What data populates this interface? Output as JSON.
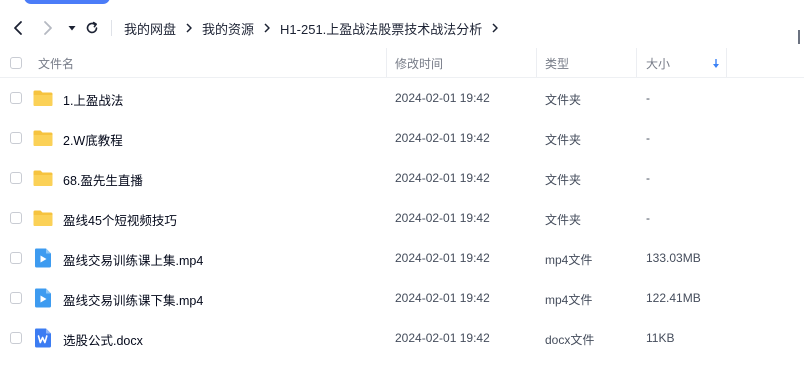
{
  "toolbar": {
    "back_icon": "chevron-left-icon",
    "forward_icon": "chevron-right-icon",
    "dropdown_icon": "caret-down-icon",
    "refresh_icon": "refresh-icon"
  },
  "breadcrumb": [
    "我的网盘",
    "我的资源",
    "H1-251.上盈战法股票技术战法分析"
  ],
  "columns": {
    "name": "文件名",
    "time": "修改时间",
    "type": "类型",
    "size": "大小"
  },
  "sort_icon": "arrow-down-icon",
  "accent": "#3b82f6",
  "files": [
    {
      "name": "1.上盈战法",
      "time": "2024-02-01 19:42",
      "type": "文件夹",
      "size": "-",
      "icon": "folder-icon"
    },
    {
      "name": "2.W底教程",
      "time": "2024-02-01 19:42",
      "type": "文件夹",
      "size": "-",
      "icon": "folder-icon"
    },
    {
      "name": "68.盈先生直播",
      "time": "2024-02-01 19:42",
      "type": "文件夹",
      "size": "-",
      "icon": "folder-icon"
    },
    {
      "name": "盈线45个短视频技巧",
      "time": "2024-02-01 19:42",
      "type": "文件夹",
      "size": "-",
      "icon": "folder-icon"
    },
    {
      "name": "盈线交易训练课上集.mp4",
      "time": "2024-02-01 19:42",
      "type": "mp4文件",
      "size": "133.03MB",
      "icon": "video-file-icon"
    },
    {
      "name": "盈线交易训练课下集.mp4",
      "time": "2024-02-01 19:42",
      "type": "mp4文件",
      "size": "122.41MB",
      "icon": "video-file-icon"
    },
    {
      "name": "选股公式.docx",
      "time": "2024-02-01 19:42",
      "type": "docx文件",
      "size": "11KB",
      "icon": "word-file-icon"
    }
  ]
}
